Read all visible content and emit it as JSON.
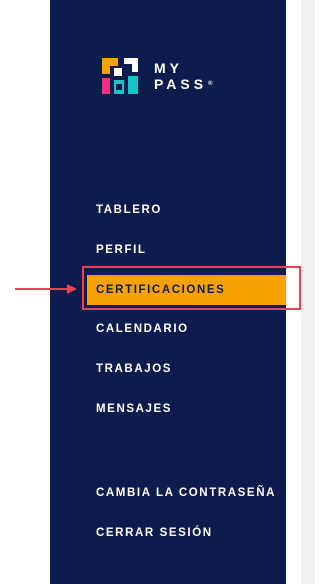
{
  "brand": {
    "line1": "MY",
    "line2": "PASS",
    "reg_mark": "®"
  },
  "nav": {
    "items": [
      {
        "label": "TABLERO"
      },
      {
        "label": "PERFIL"
      },
      {
        "label": "CERTIFICACIONES",
        "active": true
      },
      {
        "label": "CALENDARIO"
      },
      {
        "label": "TRABAJOS"
      },
      {
        "label": "MENSAJES"
      },
      {
        "label": "CAMBIA LA CONTRASEÑA"
      },
      {
        "label": "CERRAR SESIÓN"
      }
    ]
  },
  "colors": {
    "sidebar_bg": "#0e1b4d",
    "active_bg": "#f9a100",
    "annotation": "#e64452",
    "logo_orange": "#f9a100",
    "logo_teal": "#1cc2c7",
    "logo_magenta": "#e8347b"
  }
}
